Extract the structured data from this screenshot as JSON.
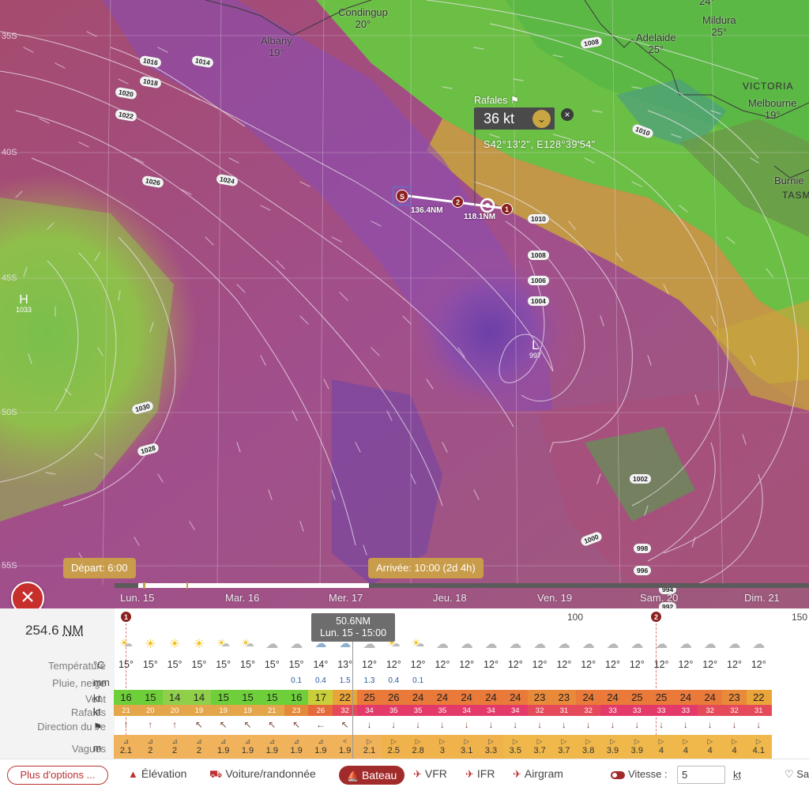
{
  "map": {
    "cities": [
      {
        "name": "Condingup",
        "temp": "20°"
      },
      {
        "name": "Albany",
        "temp": "19°"
      },
      {
        "name": "Adelaide",
        "temp": "25°"
      },
      {
        "name": "Mildura",
        "temp": "25°"
      },
      {
        "name": "Melbourne",
        "temp": "19°"
      },
      {
        "name": "Burnie",
        "temp": ""
      }
    ],
    "regions": [
      "VICTORIA",
      "TASM"
    ],
    "latitudes": [
      "35S",
      "40S",
      "45S",
      "50S",
      "55S"
    ],
    "top_temp": "24°",
    "isobars": [
      "1016",
      "1014",
      "1018",
      "1020",
      "1022",
      "1026",
      "1024",
      "1008",
      "1010",
      "1010",
      "1008",
      "1006",
      "1004",
      "1030",
      "1028",
      "1002",
      "1000",
      "998",
      "996",
      "994",
      "992"
    ],
    "high": {
      "letter": "H",
      "value": "1033"
    },
    "low": {
      "letter": "L",
      "value": "997"
    }
  },
  "gust_tooltip": {
    "title": "Rafales",
    "flag": "⚑",
    "value": "36 kt",
    "close": "×",
    "coords": "S42°13'2\", E128°39'54\""
  },
  "route": {
    "start_marker": "S",
    "wp1": "1",
    "wp2": "2",
    "leg1": "136.4NM",
    "leg2": "118.1NM"
  },
  "timeline": {
    "departure": "Départ: 6:00",
    "arrival": "Arrivée: 10:00 (2d 4h)",
    "days": [
      "Lun. 15",
      "Mar. 16",
      "Mer. 17",
      "Jeu. 18",
      "Ven. 19",
      "Sam. 20",
      "Dim. 21"
    ]
  },
  "table": {
    "distance_value": "254.6",
    "distance_unit": "NM",
    "scale": [
      "100",
      "150"
    ],
    "hover": {
      "line1": "50.6NM",
      "line2": "Lun. 15 - 15:00"
    },
    "rows": {
      "temperature": {
        "label": "Température",
        "unit": "°C"
      },
      "rain": {
        "label": "Pluie, neige",
        "unit": "mm"
      },
      "wind": {
        "label": "Vent",
        "unit": "kt"
      },
      "gusts": {
        "label": "Rafales",
        "unit": "kt"
      },
      "direction": {
        "label": "Direction du ve",
        "unit": "⚑"
      },
      "waves": {
        "label": "Vagues",
        "unit": "m"
      }
    },
    "weather": [
      "partly",
      "sun",
      "sun",
      "sun",
      "partly",
      "partly",
      "cloud",
      "cloud",
      "rain",
      "rain",
      "cloud",
      "partly",
      "partly",
      "cloud",
      "cloud",
      "cloud",
      "cloud",
      "cloud",
      "cloud",
      "cloud",
      "cloud",
      "cloud",
      "cloud",
      "cloud",
      "cloud",
      "cloud",
      "cloud"
    ],
    "temps": [
      "15°",
      "15°",
      "15°",
      "15°",
      "15°",
      "15°",
      "15°",
      "15°",
      "14°",
      "13°",
      "12°",
      "12°",
      "12°",
      "12°",
      "12°",
      "12°",
      "12°",
      "12°",
      "12°",
      "12°",
      "12°",
      "12°",
      "12°",
      "12°",
      "12°",
      "12°",
      "12°"
    ],
    "rain": [
      "",
      "",
      "",
      "",
      "",
      "",
      "",
      "0.1",
      "0.4",
      "1.5",
      "1.3",
      "0.4",
      "0.1",
      "",
      "",
      "",
      "",
      "",
      "",
      "",
      "",
      "",
      "",
      "",
      "",
      "",
      ""
    ],
    "wind": [
      16,
      15,
      14,
      14,
      15,
      15,
      15,
      16,
      17,
      22,
      25,
      26,
      24,
      24,
      24,
      24,
      24,
      23,
      23,
      24,
      24,
      25,
      25,
      24,
      24,
      23,
      22
    ],
    "gusts": [
      21,
      20,
      20,
      19,
      19,
      19,
      21,
      23,
      26,
      32,
      34,
      35,
      35,
      35,
      34,
      34,
      34,
      32,
      31,
      32,
      33,
      33,
      33,
      33,
      32,
      32,
      31
    ],
    "directions": [
      "↑",
      "↑",
      "↑",
      "↖",
      "↖",
      "↖",
      "↖",
      "↖",
      "←",
      "↖",
      "↓",
      "↓",
      "↓",
      "↓",
      "↓",
      "↓",
      "↓",
      "↓",
      "↓",
      "↓",
      "↓",
      "↓",
      "↓",
      "↓",
      "↓",
      "↓",
      "↓"
    ],
    "waves": [
      "2.1",
      "2",
      "2",
      "2",
      "1.9",
      "1.9",
      "1.9",
      "1.9",
      "1.9",
      "1.9",
      "2.1",
      "2.5",
      "2.8",
      "3",
      "3.1",
      "3.3",
      "3.5",
      "3.7",
      "3.7",
      "3.8",
      "3.9",
      "3.9",
      "4",
      "4",
      "4",
      "4",
      "4.1",
      "4.1"
    ],
    "wave_dirs": [
      "⊿",
      "⊿",
      "⊿",
      "⊿",
      "⊿",
      "⊿",
      "⊿",
      "⊿",
      "⊿",
      "<",
      "▷",
      "▷",
      "▷",
      "▷",
      "▷",
      "▷",
      "▷",
      "▷",
      "▷",
      "▷",
      "▷",
      "▷",
      "▷",
      "▷",
      "▷",
      "▷",
      "▷",
      "▷"
    ]
  },
  "bottom_bar": {
    "more_options": "Plus d'options ...",
    "modes": [
      {
        "icon": "▲",
        "label": "Élévation"
      },
      {
        "icon": "🚘",
        "label": "Voiture/randonnée"
      },
      {
        "icon": "⛵",
        "label": "Bateau"
      },
      {
        "icon": "✈",
        "label": "VFR"
      },
      {
        "icon": "✈",
        "label": "IFR"
      },
      {
        "icon": "✈",
        "label": "Airgram"
      }
    ],
    "speed_label": "Vitesse :",
    "speed_value": "5",
    "speed_unit": "kt",
    "save": "♡ Sa"
  },
  "colors": {
    "accent": "#a12b2b",
    "tag": "#c89c4a",
    "close": "#c62f2c"
  }
}
